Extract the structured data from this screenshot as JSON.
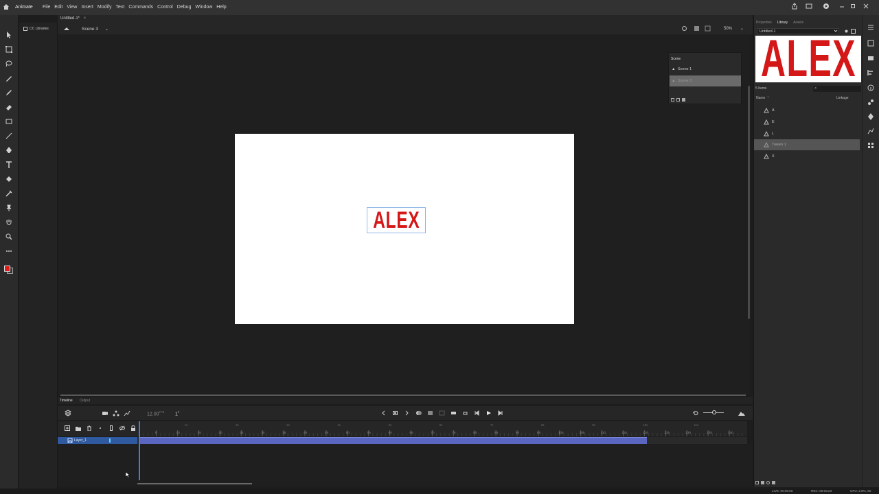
{
  "app": {
    "name": "Animate"
  },
  "menu": [
    "File",
    "Edit",
    "View",
    "Insert",
    "Modify",
    "Text",
    "Commands",
    "Control",
    "Debug",
    "Window",
    "Help"
  ],
  "document": {
    "tab_title": "Untitled-1*"
  },
  "cc_libraries": {
    "label": "CC Libraries"
  },
  "stage_header": {
    "scene_label": "Scene 3",
    "zoom": "50%"
  },
  "stage": {
    "text": "ALEX",
    "text_color": "#d41717",
    "bg": "#ffffff"
  },
  "scene_panel": {
    "title": "Scene",
    "scenes": [
      {
        "name": "Scene 1",
        "selected": false
      },
      {
        "name": "Scene 3",
        "selected": true
      }
    ]
  },
  "timeline": {
    "tabs": {
      "timeline": "Timeline",
      "output": "Output"
    },
    "fps": "12.00",
    "fps_unit": "FPS",
    "current_frame": "1",
    "frame_unit": "F",
    "layer_name": "Layer_1",
    "ruler_labels": [
      "5",
      "10",
      "15",
      "20",
      "25",
      "30",
      "35",
      "40",
      "45",
      "50",
      "55",
      "60",
      "65",
      "70",
      "75",
      "80",
      "85",
      "90",
      "95",
      "100",
      "105",
      "110",
      "115",
      "120",
      "125",
      "130",
      "135",
      "140"
    ],
    "second_marks": [
      "1s",
      "2s",
      "3s",
      "4s",
      "5s",
      "6s",
      "7s",
      "8s",
      "9s",
      "10s",
      "11s"
    ],
    "tween_end_frame": 120
  },
  "library": {
    "tabs": [
      "Properties",
      "Library",
      "Assets"
    ],
    "active_tab": "Library",
    "document": "Untitled-1",
    "preview_text": "ALEX",
    "item_count": "5 Items",
    "columns": {
      "name": "Name",
      "linkage": "Linkage"
    },
    "items": [
      {
        "name": "A",
        "selected": false
      },
      {
        "name": "E",
        "selected": false
      },
      {
        "name": "L",
        "selected": false
      },
      {
        "name": "Tween 1",
        "selected": true
      },
      {
        "name": "X",
        "selected": false
      }
    ]
  },
  "status": {
    "live": "LIVE: 00:00:00",
    "rec": "REC: 00:03:23",
    "cpu": "CPU: 2.8%, 60"
  },
  "colors": {
    "stroke_swatch": "#333333",
    "fill_swatch": "#e31b1b",
    "accent": "#3f7fd6",
    "tween": "#5a66bf"
  }
}
